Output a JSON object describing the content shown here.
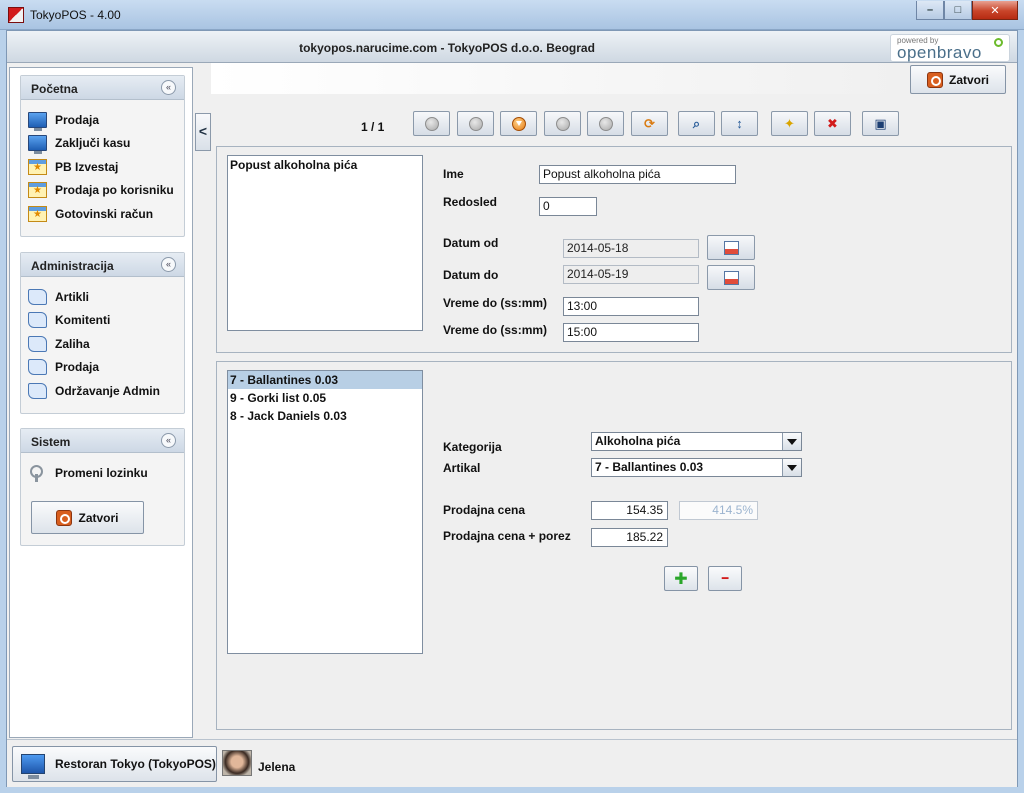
{
  "window": {
    "title": "TokyoPOS - 4.00",
    "minimize": "–",
    "maximize": "□",
    "close": "✕"
  },
  "header": {
    "text": "tokyopos.narucime.com - TokyoPOS d.o.o. Beograd",
    "logo_small": "powered by",
    "logo_big": "openbravo"
  },
  "sidebar": {
    "sections": [
      {
        "title": "Početna",
        "items": [
          "Prodaja",
          "Zaključi kasu",
          "PB Izvestaj",
          "Prodaja po korisniku",
          "Gotovinski račun"
        ]
      },
      {
        "title": "Administracija",
        "items": [
          "Artikli",
          "Komitenti",
          "Zaliha",
          "Prodaja",
          "Održavanje Admin"
        ]
      },
      {
        "title": "Sistem",
        "items": [
          "Promeni lozinku"
        ],
        "button": "Zatvori"
      }
    ],
    "toggle_glyph": "«",
    "collapse_glyph": "<"
  },
  "top": {
    "close_button": "Zatvori"
  },
  "toolbar": {
    "pager": "1 / 1",
    "refresh_glyph": "⟳",
    "search_glyph": "⌕",
    "sort_glyph": "↕",
    "new_glyph": "✦",
    "delete_glyph": "✖",
    "save_glyph": "▣"
  },
  "discount_list": [
    "Popust alkoholna pića"
  ],
  "form": {
    "ime_label": "Ime",
    "ime_value": "Popust alkoholna pića",
    "redosled_label": "Redosled",
    "redosled_value": "0",
    "datum_od_label": "Datum od",
    "datum_od_value": "2014-05-18",
    "datum_do_label": "Datum do",
    "datum_do_value": "2014-05-19",
    "vreme_od_label": "Vreme do (ss:mm)",
    "vreme_od_value": "13:00",
    "vreme_do_label": "Vreme do (ss:mm)",
    "vreme_do_value": "15:00"
  },
  "products_list": [
    "7 - Ballantines 0.03",
    "9 - Gorki list 0.05",
    "8 - Jack Daniels 0.03"
  ],
  "product_form": {
    "kategorija_label": "Kategorija",
    "kategorija_value": "Alkoholna pića",
    "artikal_label": "Artikal",
    "artikal_value": "7 - Ballantines 0.03",
    "cena_label": "Prodajna cena",
    "cena_value": "154.35",
    "cena_percent": "414.5%",
    "cena_porez_label": "Prodajna cena + porez",
    "cena_porez_value": "185.22",
    "add_glyph": "✚",
    "remove_glyph": "━"
  },
  "status": {
    "restaurant": "Restoran Tokyo (TokyoPOS)",
    "user": "Jelena"
  },
  "colors": {
    "accent": "#d85e1e",
    "selection": "#b8cfe5",
    "add_green": "#2aa62a",
    "remove_red": "#d21b1b"
  }
}
